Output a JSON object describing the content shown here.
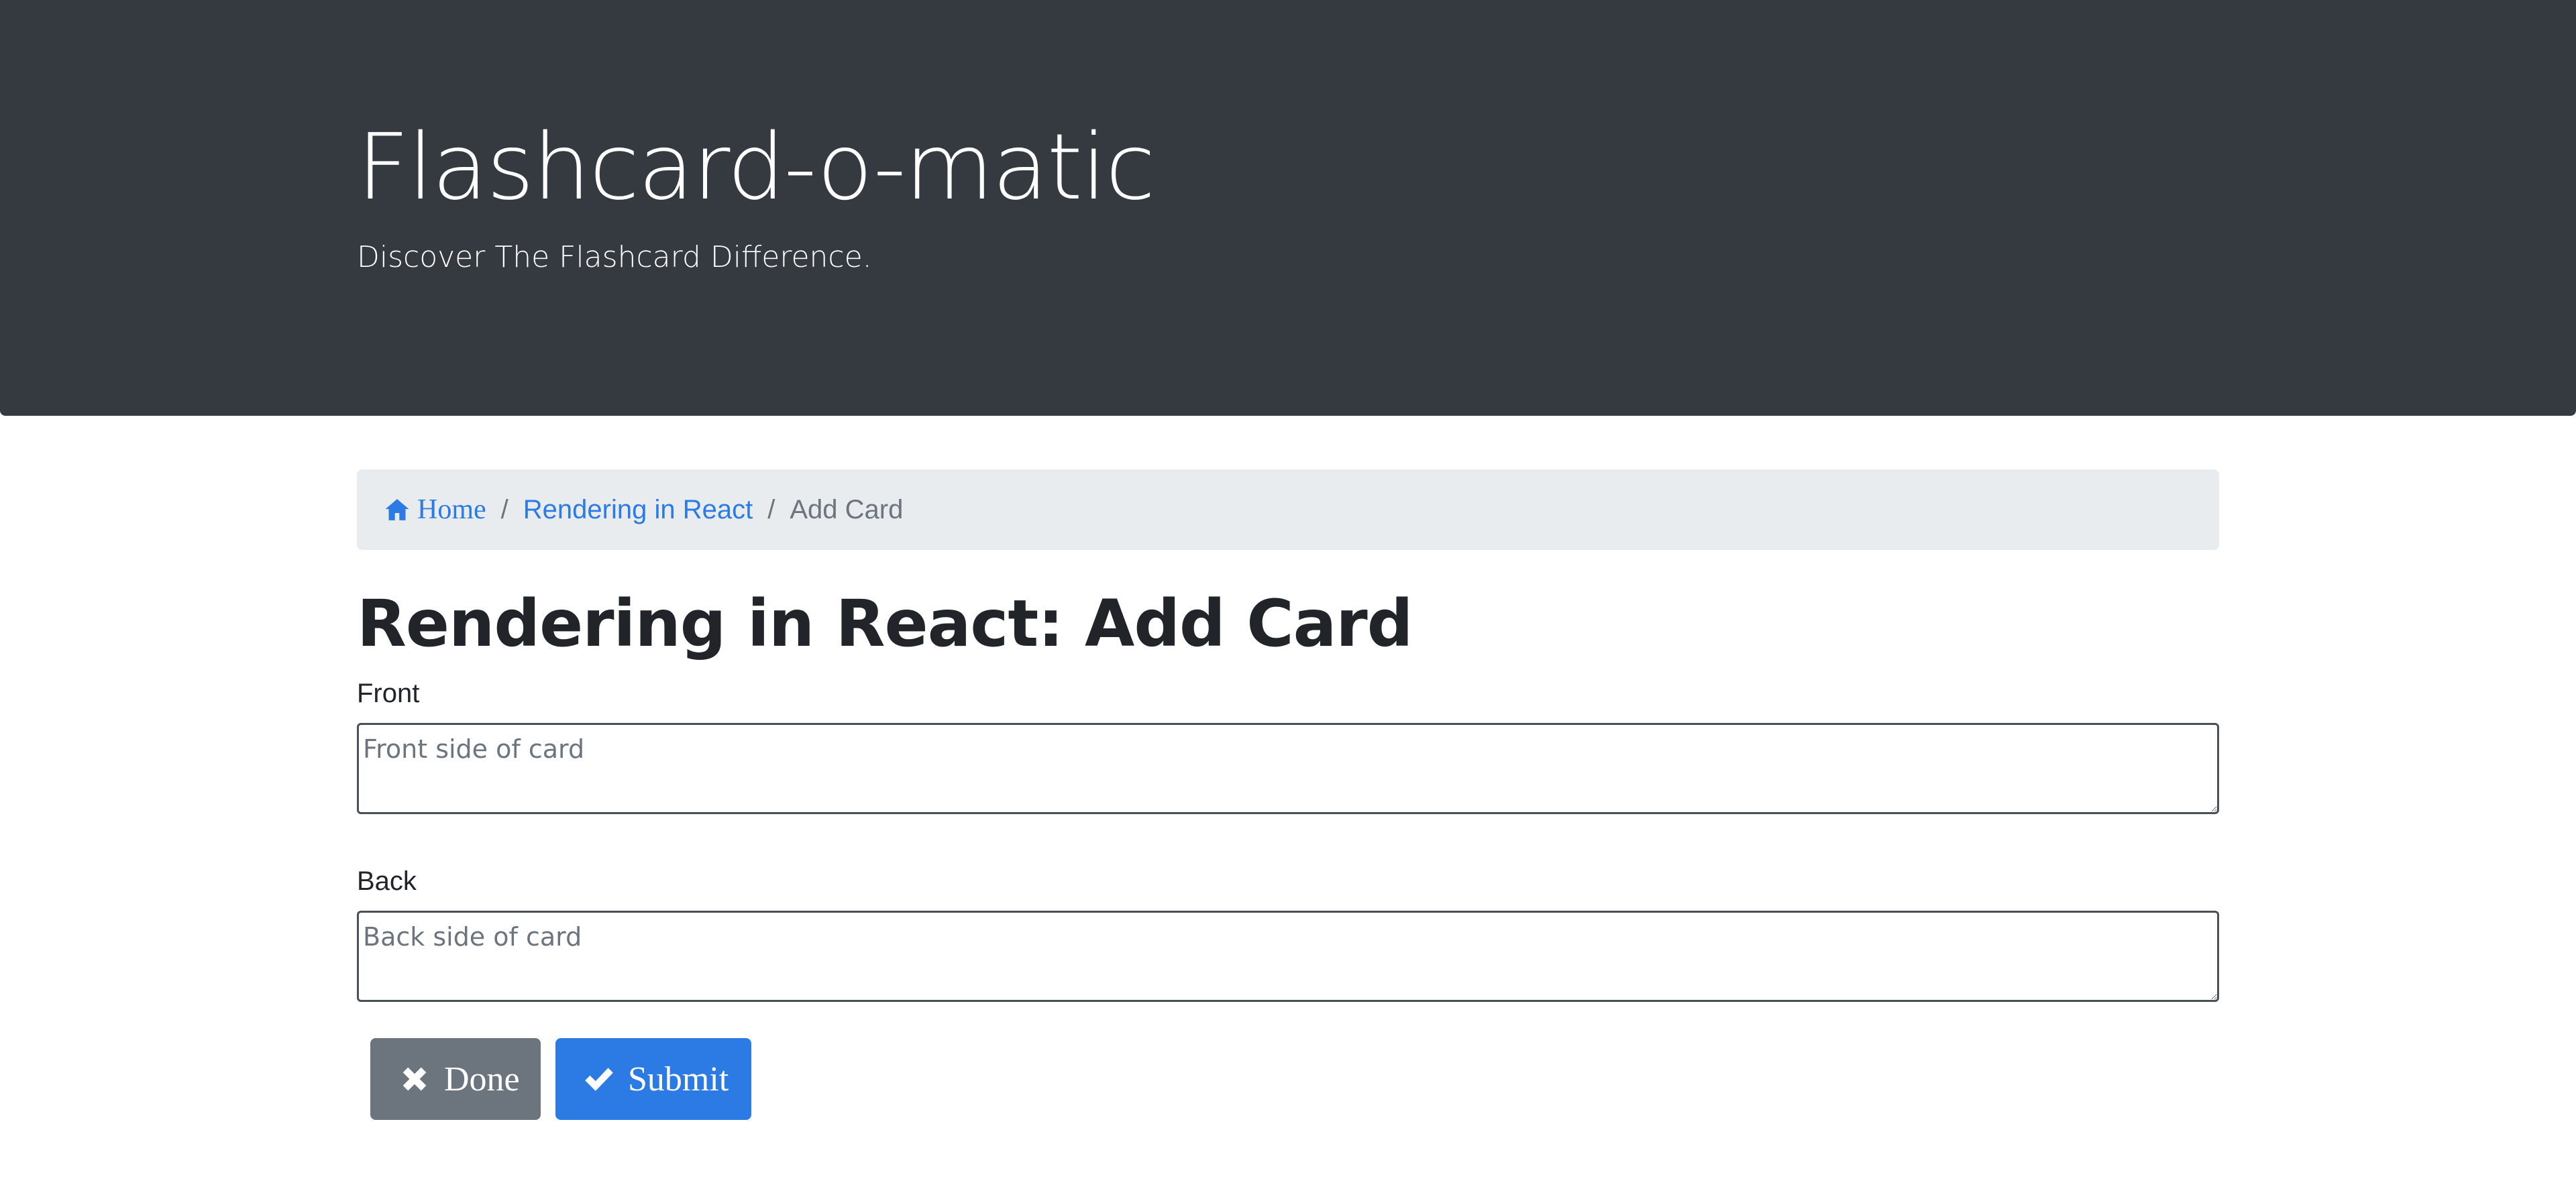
{
  "header": {
    "title": "Flashcard-o-matic",
    "subtitle": "Discover The Flashcard Difference."
  },
  "breadcrumb": {
    "home_icon": "home-icon",
    "home": "Home",
    "deck": "Rendering in React",
    "current": "Add Card",
    "separator": "/"
  },
  "page": {
    "title": "Rendering in React: Add Card"
  },
  "form": {
    "front_label": "Front",
    "front_placeholder": "Front side of card",
    "back_label": "Back",
    "back_placeholder": "Back side of card"
  },
  "buttons": {
    "done_icon": "close-icon",
    "done": "Done",
    "submit_icon": "checkmark-icon",
    "submit": "Submit"
  },
  "colors": {
    "header_bg": "#343a40",
    "link": "#2c7be5",
    "breadcrumb_bg": "#e9ecef",
    "done_bg": "#6c757d",
    "submit_bg": "#2c7be5"
  }
}
